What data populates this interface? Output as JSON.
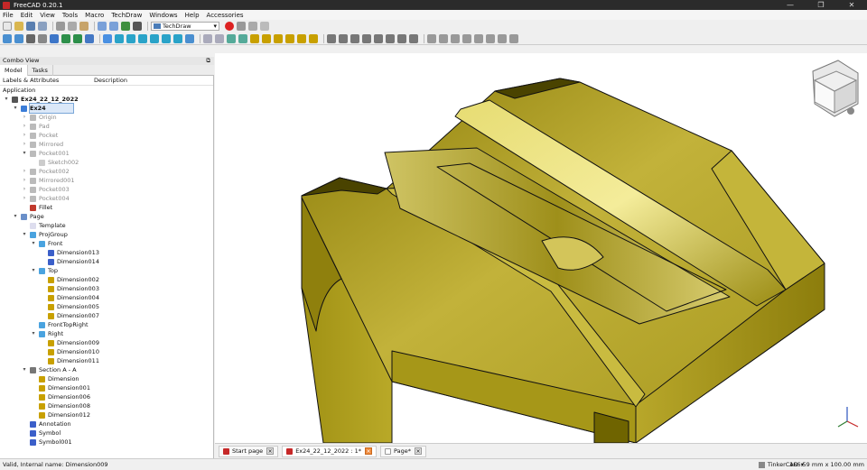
{
  "window": {
    "title": "FreeCAD 0.20.1",
    "controls": [
      "—",
      "❐",
      "✕"
    ]
  },
  "menu": [
    "File",
    "Edit",
    "View",
    "Tools",
    "Macro",
    "TechDraw",
    "Windows",
    "Help",
    "Accessories"
  ],
  "workbench": {
    "selected": "TechDraw"
  },
  "combo_view": {
    "title": "Combo View",
    "tabs": [
      "Model",
      "Tasks"
    ]
  },
  "tree": {
    "columns": [
      "Labels & Attributes",
      "Description"
    ],
    "root": "Application",
    "rows": [
      {
        "label": "Ex24_22_12_2022",
        "indent": 0,
        "arrow": "▾",
        "icon": "#555",
        "dim": false,
        "bold": true
      },
      {
        "label": "Ex24",
        "indent": 1,
        "arrow": "▾",
        "icon": "#3b7dd8",
        "dim": false,
        "bold": true,
        "selected": true
      },
      {
        "label": "Origin",
        "indent": 2,
        "arrow": "›",
        "icon": "#bbb",
        "dim": true
      },
      {
        "label": "Pad",
        "indent": 2,
        "arrow": "›",
        "icon": "#bbb",
        "dim": true
      },
      {
        "label": "Pocket",
        "indent": 2,
        "arrow": "›",
        "icon": "#bbb",
        "dim": true
      },
      {
        "label": "Mirrored",
        "indent": 2,
        "arrow": "›",
        "icon": "#bbb",
        "dim": true
      },
      {
        "label": "Pocket001",
        "indent": 2,
        "arrow": "▾",
        "icon": "#bbb",
        "dim": true
      },
      {
        "label": "Sketch002",
        "indent": 3,
        "arrow": "",
        "icon": "#ccc",
        "dim": true
      },
      {
        "label": "Pocket002",
        "indent": 2,
        "arrow": "›",
        "icon": "#bbb",
        "dim": true
      },
      {
        "label": "Mirrored001",
        "indent": 2,
        "arrow": "›",
        "icon": "#bbb",
        "dim": true
      },
      {
        "label": "Pocket003",
        "indent": 2,
        "arrow": "›",
        "icon": "#bbb",
        "dim": true
      },
      {
        "label": "Pocket004",
        "indent": 2,
        "arrow": "›",
        "icon": "#bbb",
        "dim": true
      },
      {
        "label": "Fillet",
        "indent": 2,
        "arrow": "",
        "icon": "#c0392b",
        "dim": false
      },
      {
        "label": "Page",
        "indent": 1,
        "arrow": "▾",
        "icon": "#6a8fc9",
        "dim": false
      },
      {
        "label": "Template",
        "indent": 2,
        "arrow": "",
        "icon": "#dde",
        "dim": false
      },
      {
        "label": "ProjGroup",
        "indent": 2,
        "arrow": "▾",
        "icon": "#4aa3df",
        "dim": false
      },
      {
        "label": "Front",
        "indent": 3,
        "arrow": "▾",
        "icon": "#4aa3df",
        "dim": false
      },
      {
        "label": "Dimension013",
        "indent": 4,
        "arrow": "",
        "icon": "#3b5fc9",
        "dim": false
      },
      {
        "label": "Dimension014",
        "indent": 4,
        "arrow": "",
        "icon": "#3b5fc9",
        "dim": false
      },
      {
        "label": "Top",
        "indent": 3,
        "arrow": "▾",
        "icon": "#4aa3df",
        "dim": false
      },
      {
        "label": "Dimension002",
        "indent": 4,
        "arrow": "",
        "icon": "#c8a000",
        "dim": false
      },
      {
        "label": "Dimension003",
        "indent": 4,
        "arrow": "",
        "icon": "#c8a000",
        "dim": false
      },
      {
        "label": "Dimension004",
        "indent": 4,
        "arrow": "",
        "icon": "#c8a000",
        "dim": false
      },
      {
        "label": "Dimension005",
        "indent": 4,
        "arrow": "",
        "icon": "#c8a000",
        "dim": false
      },
      {
        "label": "Dimension007",
        "indent": 4,
        "arrow": "",
        "icon": "#c8a000",
        "dim": false
      },
      {
        "label": "FrontTopRight",
        "indent": 3,
        "arrow": "",
        "icon": "#4aa3df",
        "dim": false
      },
      {
        "label": "Right",
        "indent": 3,
        "arrow": "▾",
        "icon": "#4aa3df",
        "dim": false
      },
      {
        "label": "Dimension009",
        "indent": 4,
        "arrow": "",
        "icon": "#c8a000",
        "dim": false
      },
      {
        "label": "Dimension010",
        "indent": 4,
        "arrow": "",
        "icon": "#c8a000",
        "dim": false
      },
      {
        "label": "Dimension011",
        "indent": 4,
        "arrow": "",
        "icon": "#c8a000",
        "dim": false
      },
      {
        "label": "Section A - A",
        "indent": 2,
        "arrow": "▾",
        "icon": "#777",
        "dim": false
      },
      {
        "label": "Dimension",
        "indent": 3,
        "arrow": "",
        "icon": "#c8a000",
        "dim": false
      },
      {
        "label": "Dimension001",
        "indent": 3,
        "arrow": "",
        "icon": "#c8a000",
        "dim": false
      },
      {
        "label": "Dimension006",
        "indent": 3,
        "arrow": "",
        "icon": "#c8a000",
        "dim": false
      },
      {
        "label": "Dimension008",
        "indent": 3,
        "arrow": "",
        "icon": "#c8a000",
        "dim": false
      },
      {
        "label": "Dimension012",
        "indent": 3,
        "arrow": "",
        "icon": "#c8a000",
        "dim": false
      },
      {
        "label": "Annotation",
        "indent": 2,
        "arrow": "",
        "icon": "#3b5fc9",
        "dim": false
      },
      {
        "label": "Symbol",
        "indent": 2,
        "arrow": "",
        "icon": "#3b5fc9",
        "dim": false
      },
      {
        "label": "Symbol001",
        "indent": 2,
        "arrow": "",
        "icon": "#3b5fc9",
        "dim": false
      }
    ]
  },
  "doc_tabs": [
    {
      "label": "Start page",
      "active": false,
      "close_orange": false
    },
    {
      "label": "Ex24_22_12_2022 : 1*",
      "active": true,
      "close_orange": true
    },
    {
      "label": "Page*",
      "active": false,
      "close_orange": false
    }
  ],
  "status": {
    "message": "Valid, Internal name: Dimension009",
    "navigation": "TinkerCAD",
    "dimensions": "166.59 mm x 100.00 mm"
  },
  "colors": {
    "model_face": "#b5a51e",
    "model_dark": "#6f6400",
    "model_light": "#e4da7a",
    "outline": "#111111"
  }
}
